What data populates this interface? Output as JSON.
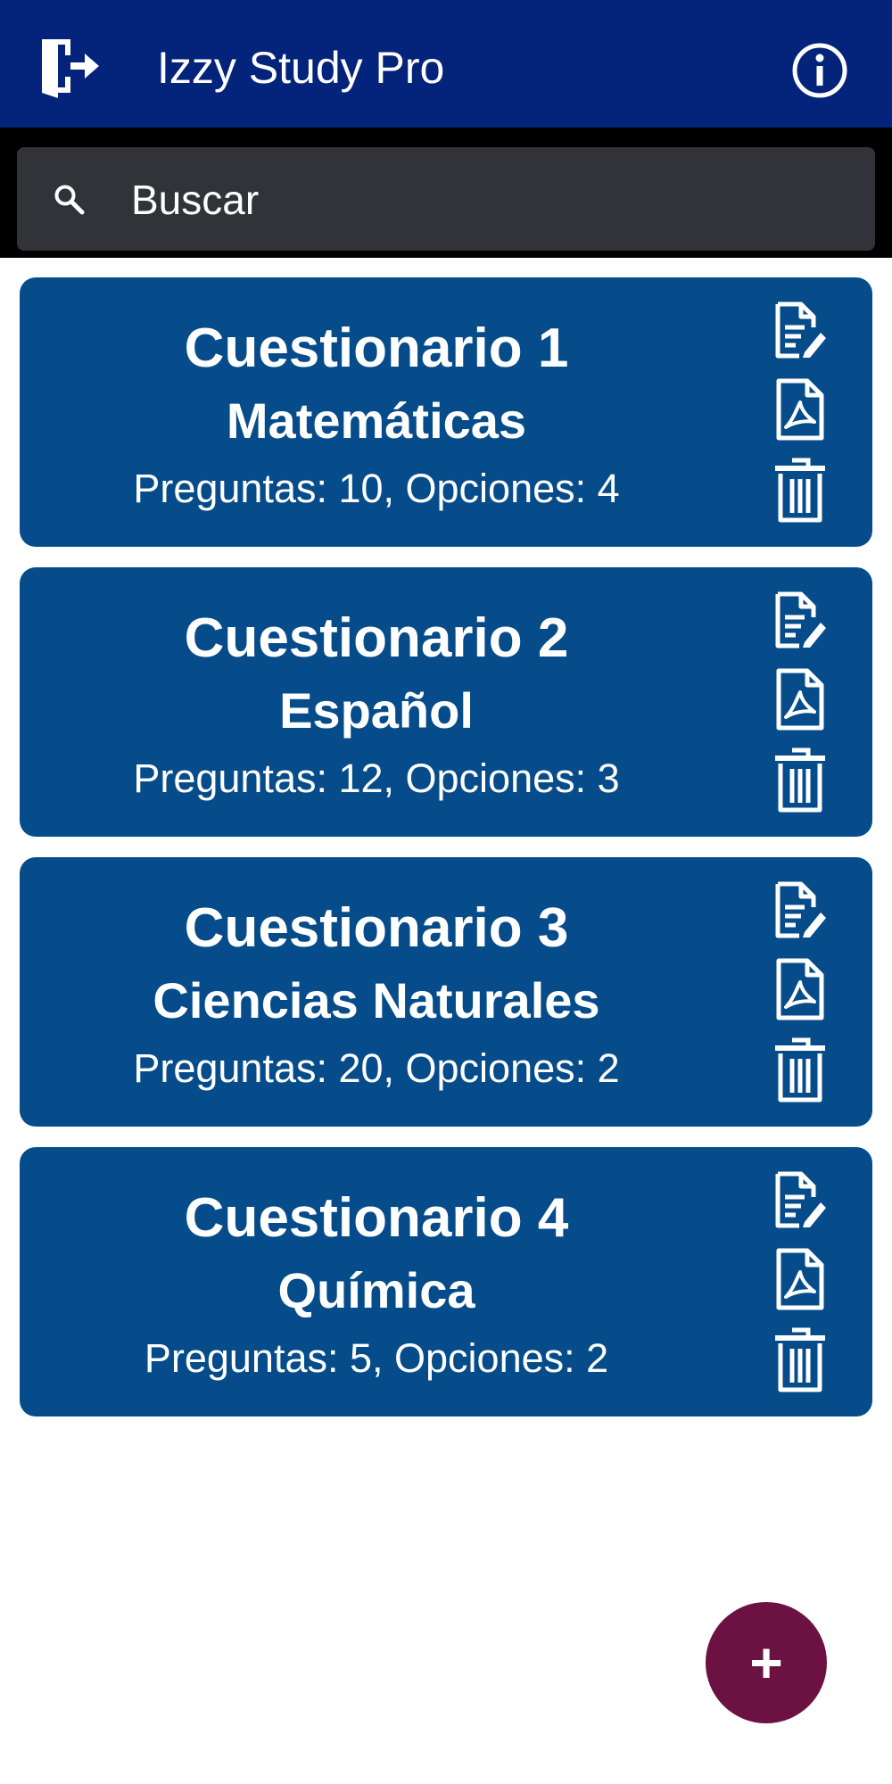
{
  "app": {
    "title": "Izzy Study Pro",
    "icons": {
      "exit": "exit-door-icon",
      "info": "info-icon"
    },
    "colors": {
      "appbar": "#04237a",
      "card": "#064c8a",
      "fab": "#6b1243",
      "search_box": "#323338"
    }
  },
  "search": {
    "placeholder": "Buscar",
    "value": "",
    "icon": "search-icon"
  },
  "quizzes": [
    {
      "title": "Cuestionario 1",
      "subject": "Matemáticas",
      "meta": "Preguntas: 10, Opciones: 4"
    },
    {
      "title": "Cuestionario 2",
      "subject": "Español",
      "meta": "Preguntas: 12, Opciones: 3"
    },
    {
      "title": "Cuestionario 3",
      "subject": "Ciencias Naturales",
      "meta": "Preguntas: 20, Opciones: 2"
    },
    {
      "title": "Cuestionario 4",
      "subject": "Química",
      "meta": "Preguntas: 5, Opciones: 2"
    }
  ],
  "card_actions": {
    "edit": "edit-document-icon",
    "pdf": "pdf-file-icon",
    "delete": "trash-icon"
  },
  "fab": {
    "label": "+",
    "icon": "plus-icon"
  }
}
